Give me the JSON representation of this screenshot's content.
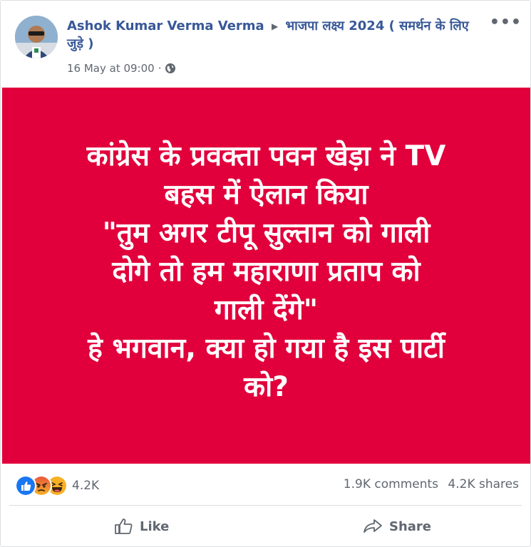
{
  "post": {
    "author": "Ashok Kumar Verma Verma",
    "group": "भाजपा लक्ष्य 2024 ( समर्थन के लिए जुड़े )",
    "timestamp": "16 May at 09:00",
    "separator": "·",
    "more_label": "•••"
  },
  "image_text": {
    "lines": [
      "कांग्रेस के प्रवक्ता पवन खेड़ा ने TV",
      "बहस में ऐलान किया",
      "\"तुम अगर टीपू सुल्तान को गाली",
      "दोगे तो हम महाराणा प्रताप को",
      "गाली देंगे\"",
      "हे भगवान, क्या हो गया है इस पार्टी",
      "को?"
    ]
  },
  "engagement": {
    "reaction_count": "4.2K",
    "comments": "1.9K comments",
    "shares": "4.2K shares"
  },
  "actions": {
    "like_label": "Like",
    "share_label": "Share"
  },
  "colors": {
    "image_background": "#e1003b",
    "link": "#385898",
    "muted": "#606770"
  }
}
